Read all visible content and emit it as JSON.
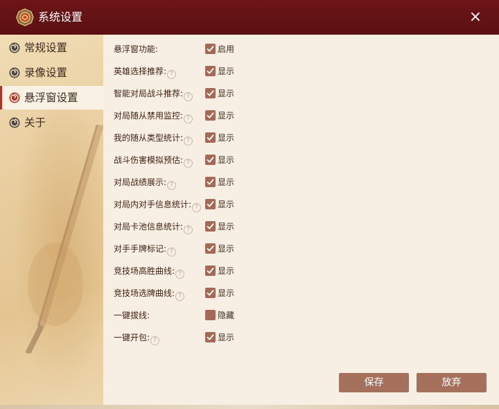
{
  "window": {
    "title": "系统设置",
    "close_symbol": "×"
  },
  "sidebar": {
    "items": [
      {
        "label": "常规设置",
        "icon": "swirl-icon",
        "active": false
      },
      {
        "label": "录像设置",
        "icon": "swirl-icon",
        "active": false
      },
      {
        "label": "悬浮窗设置",
        "icon": "swirl-icon",
        "active": true
      },
      {
        "label": "关于",
        "icon": "swirl-icon",
        "active": false
      }
    ]
  },
  "settings": [
    {
      "label": "悬浮窗功能:",
      "help": false,
      "checked": true,
      "value": "启用"
    },
    {
      "label": "英雄选择推荐:",
      "help": true,
      "checked": true,
      "value": "显示"
    },
    {
      "label": "智能对局战斗推荐:",
      "help": true,
      "checked": true,
      "value": "显示"
    },
    {
      "label": "对局随从禁用监控:",
      "help": true,
      "checked": true,
      "value": "显示"
    },
    {
      "label": "我的随从类型统计:",
      "help": true,
      "checked": true,
      "value": "显示"
    },
    {
      "label": "战斗伤害模拟预估:",
      "help": true,
      "checked": true,
      "value": "显示"
    },
    {
      "label": "对局战绩展示:",
      "help": true,
      "checked": true,
      "value": "显示"
    },
    {
      "label": "对局内对手信息统计:",
      "help": true,
      "checked": true,
      "value": "显示"
    },
    {
      "label": "对局卡池信息统计:",
      "help": true,
      "checked": true,
      "value": "显示"
    },
    {
      "label": "对手手牌标记:",
      "help": true,
      "checked": true,
      "value": "显示"
    },
    {
      "label": "竞技场高胜曲线:",
      "help": true,
      "checked": true,
      "value": "显示"
    },
    {
      "label": "竞技场选牌曲线:",
      "help": true,
      "checked": true,
      "value": "显示"
    },
    {
      "label": "一键拔线:",
      "help": false,
      "checked": false,
      "value": "隐藏"
    },
    {
      "label": "一键开包:",
      "help": true,
      "checked": true,
      "value": "显示"
    }
  ],
  "help_symbol": "?",
  "buttons": {
    "save": "保存",
    "discard": "放弃"
  },
  "colors": {
    "titlebar": "#5b1013",
    "accent": "#a8382b",
    "checkbox": "#a36b57",
    "button": "#a5705c"
  }
}
